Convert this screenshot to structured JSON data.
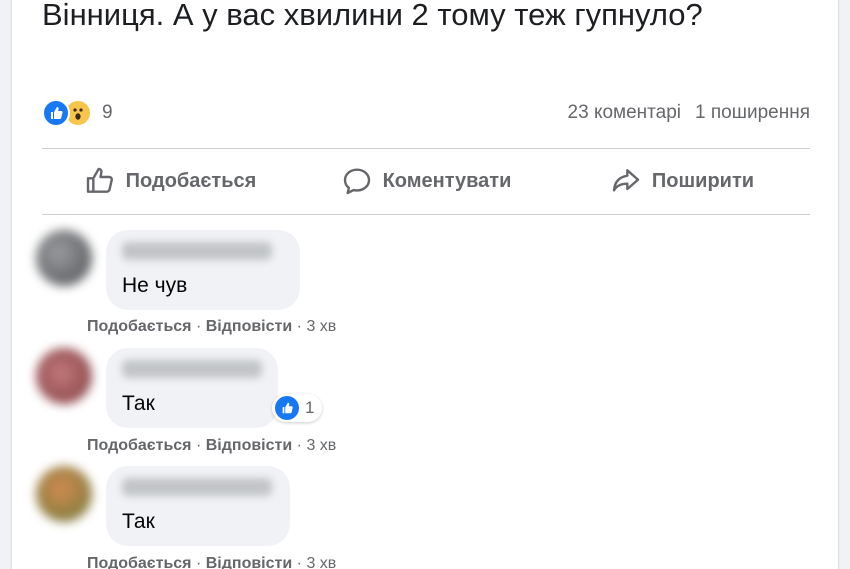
{
  "post": {
    "text": "Вінниця. А у вас хвилини 2 тому теж гупнуло?"
  },
  "stats": {
    "reaction_count": "9",
    "reaction_icons": [
      "like-icon",
      "wow-icon"
    ],
    "comments": "23 коментарі",
    "shares": "1 поширення"
  },
  "actions": {
    "like": "Подобається",
    "comment": "Коментувати",
    "share": "Поширити"
  },
  "comments": [
    {
      "text": "Не чув",
      "like_label": "Подобається",
      "reply_label": "Відповісти",
      "time": "3 хв",
      "avatar_color": "#7a7d80"
    },
    {
      "text": "Так",
      "like_label": "Подобається",
      "reply_label": "Відповісти",
      "time": "3 хв",
      "reaction_count": "1",
      "avatar_color": "#a8585a"
    },
    {
      "text": "Так",
      "like_label": "Подобається",
      "reply_label": "Відповісти",
      "time": "3 хв",
      "avatar_color": "#b86a3a"
    }
  ],
  "separator": "·",
  "colors": {
    "accent": "#1877f2",
    "text_secondary": "#65676b",
    "bubble": "#f0f2f5"
  }
}
